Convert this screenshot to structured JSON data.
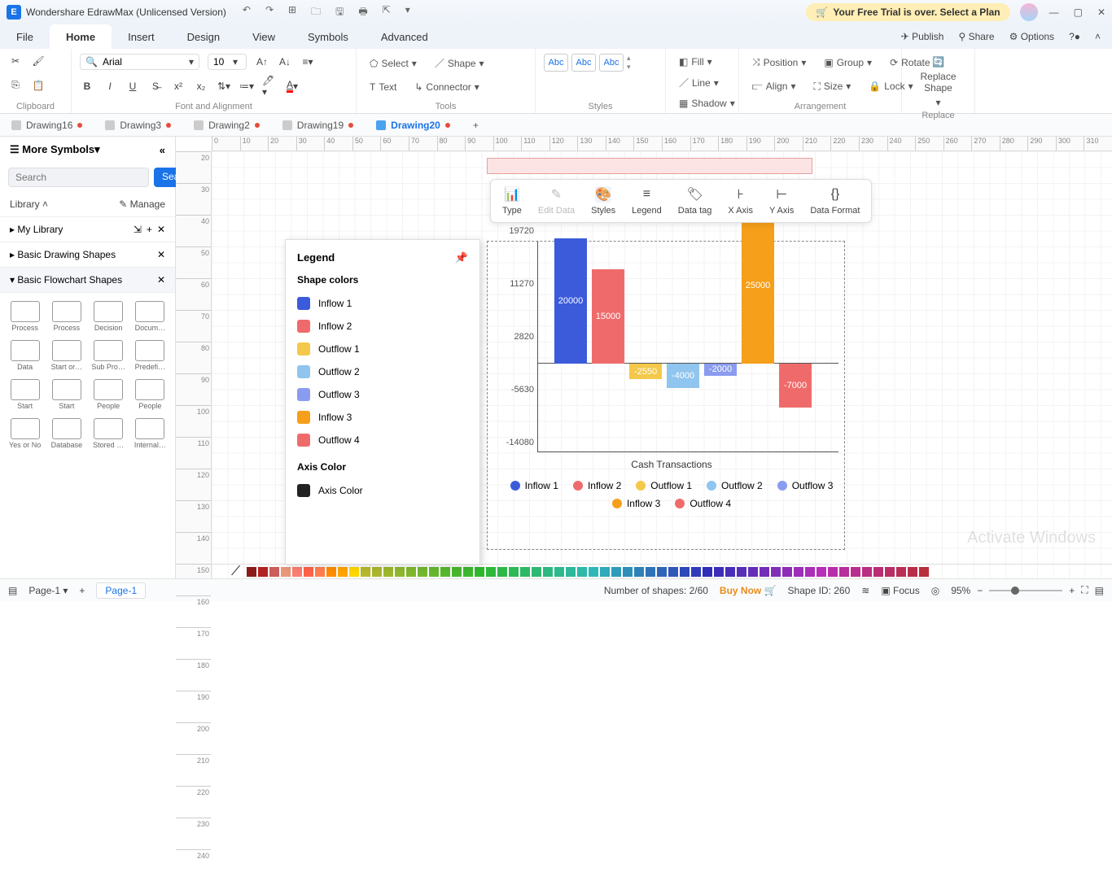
{
  "titlebar": {
    "app_name": "Wondershare EdrawMax (Unlicensed Version)",
    "trial_msg": "Your Free Trial is over. Select a Plan"
  },
  "menus": {
    "file": "File",
    "home": "Home",
    "insert": "Insert",
    "design": "Design",
    "view": "View",
    "symbols": "Symbols",
    "advanced": "Advanced",
    "publish": "Publish",
    "share": "Share",
    "options": "Options"
  },
  "ribbon": {
    "clipboard": "Clipboard",
    "font_align": "Font and Alignment",
    "tools": "Tools",
    "styles": "Styles",
    "arrangement": "Arrangement",
    "replace": "Replace",
    "font_name": "Arial",
    "font_size": "10",
    "select": "Select",
    "shape": "Shape",
    "text": "Text",
    "connector": "Connector",
    "abc": "Abc",
    "fill": "Fill",
    "line": "Line",
    "shadow": "Shadow",
    "position": "Position",
    "align": "Align",
    "group": "Group",
    "size": "Size",
    "rotate": "Rotate",
    "lock": "Lock",
    "replace_shape": "Replace Shape"
  },
  "doctabs": [
    {
      "label": "Drawing16",
      "active": false,
      "dirty": true
    },
    {
      "label": "Drawing3",
      "active": false,
      "dirty": true
    },
    {
      "label": "Drawing2",
      "active": false,
      "dirty": true
    },
    {
      "label": "Drawing19",
      "active": false,
      "dirty": true
    },
    {
      "label": "Drawing20",
      "active": true,
      "dirty": true
    }
  ],
  "sidebar": {
    "more": "More Symbols",
    "search_ph": "Search",
    "search_btn": "Search",
    "library": "Library",
    "manage": "Manage",
    "mylib": "My Library",
    "cat_basic": "Basic Drawing Shapes",
    "cat_flow": "Basic Flowchart Shapes",
    "shapes": [
      "Process",
      "Process",
      "Decision",
      "Docum…",
      "Data",
      "Start or…",
      "Sub Pro…",
      "Predefi…",
      "Start",
      "Start",
      "People",
      "People",
      "Yes or No",
      "Database",
      "Stored …",
      "Internal…"
    ]
  },
  "chart_toolbar": [
    "Type",
    "Edit Data",
    "Styles",
    "Legend",
    "Data tag",
    "X Axis",
    "Y Axis",
    "Data Format"
  ],
  "styles_panel": {
    "title": "Legend",
    "shape_colors": "Shape colors",
    "axis_color": "Axis Color",
    "axis_color_item": "Axis Color",
    "items": [
      {
        "label": "Inflow 1",
        "color": "#3b5bdb"
      },
      {
        "label": "Inflow 2",
        "color": "#ef6b6b"
      },
      {
        "label": "Outflow 1",
        "color": "#f4c84a"
      },
      {
        "label": "Outflow 2",
        "color": "#8fc5ef"
      },
      {
        "label": "Outflow 3",
        "color": "#8a9cf0"
      },
      {
        "label": "Inflow 3",
        "color": "#f59f1a"
      },
      {
        "label": "Outflow 4",
        "color": "#ef6b6b"
      }
    ]
  },
  "chart_data": {
    "type": "bar",
    "title": "Cash Transactions",
    "xlabel": "Cash Transactions",
    "ylabel": "",
    "ylim": [
      -14080,
      19720
    ],
    "yticks": [
      -14080,
      -5630,
      2820,
      11270,
      19720
    ],
    "categories": [
      "Inflow 1",
      "Inflow 2",
      "Outflow 1",
      "Outflow 2",
      "Outflow 3",
      "Inflow 3",
      "Outflow 4"
    ],
    "values": [
      20000,
      15000,
      -2550,
      -4000,
      -2000,
      25000,
      -7000
    ],
    "colors": [
      "#3b5bdb",
      "#ef6b6b",
      "#f4c84a",
      "#8fc5ef",
      "#8a9cf0",
      "#f59f1a",
      "#ef6b6b"
    ]
  },
  "watermark": "Activate Windows",
  "statusbar": {
    "page_sel": "Page-1",
    "page_tab": "Page-1",
    "shapes_count": "Number of shapes: 2/60",
    "buy": "Buy Now",
    "shape_id": "Shape ID: 260",
    "focus": "Focus",
    "zoom": "95%"
  },
  "color_strip": [
    "#c0392b",
    "#d35400",
    "#f39c12",
    "#f1c40f",
    "#cddc39",
    "#8bc34a",
    "#4caf50",
    "#009688",
    "#00bcd4",
    "#2196f3",
    "#3f51b5",
    "#673ab7",
    "#9c27b0",
    "#e91e63",
    "#795548",
    "#607d8b"
  ]
}
